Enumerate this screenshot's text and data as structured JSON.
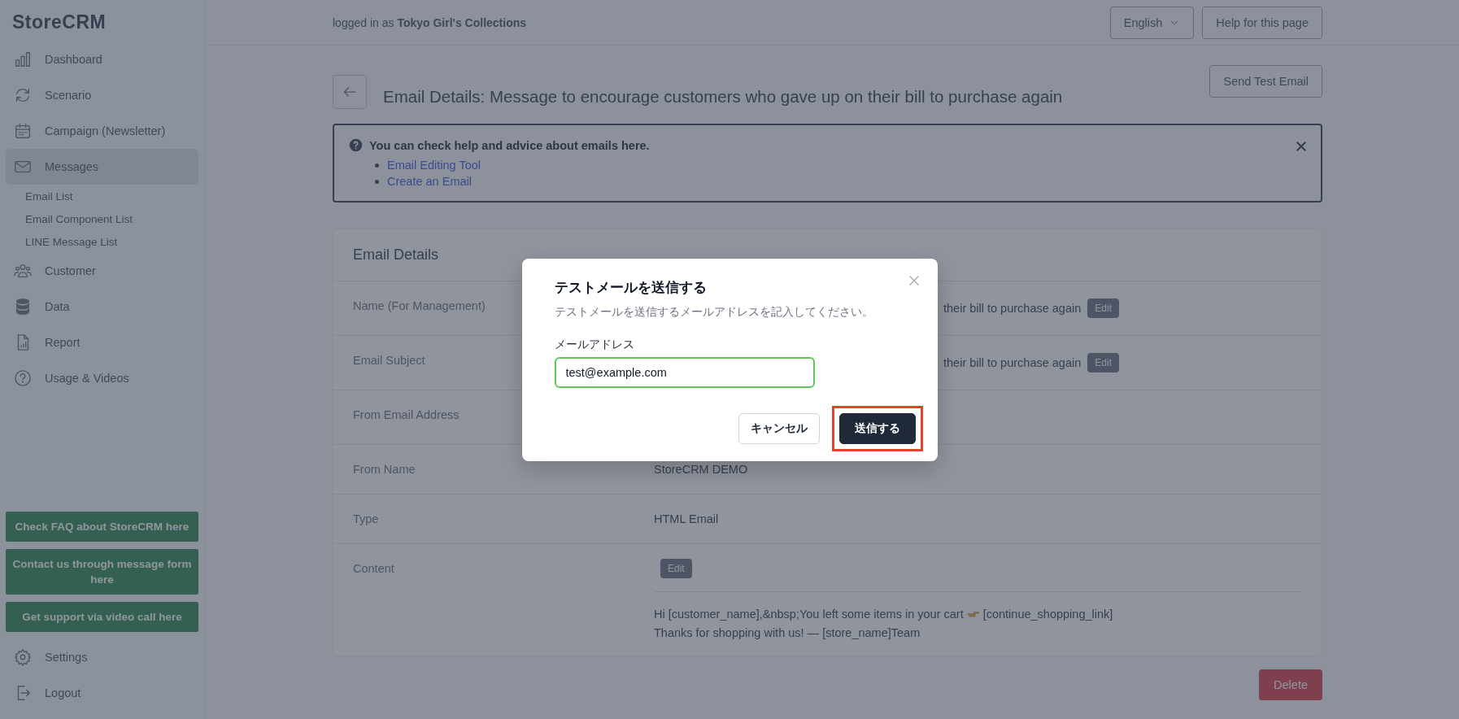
{
  "sidebar": {
    "logo": "StoreCRM",
    "items": [
      {
        "label": "Dashboard",
        "selected": false
      },
      {
        "label": "Scenario",
        "selected": false
      },
      {
        "label": "Campaign (Newsletter)",
        "selected": false
      },
      {
        "label": "Messages",
        "selected": true,
        "children": [
          {
            "label": "Email List"
          },
          {
            "label": "Email Component List"
          },
          {
            "label": "LINE Message List"
          }
        ]
      },
      {
        "label": "Customer",
        "selected": false
      },
      {
        "label": "Data",
        "selected": false
      },
      {
        "label": "Report",
        "selected": false
      },
      {
        "label": "Usage & Videos",
        "selected": false
      }
    ],
    "support_buttons": [
      "Check FAQ about StoreCRM here",
      "Contact us through message form here",
      "Get support via video call here"
    ],
    "bottom_items": [
      {
        "label": "Settings"
      },
      {
        "label": "Logout"
      }
    ]
  },
  "header": {
    "login_text": "logged in as **Tokyo Girl's Collections**",
    "language": "English",
    "help_button": "Help for this page"
  },
  "page": {
    "title": "Email Details: Message to encourage customers who gave up on their bill to purchase again",
    "send_test_button": "Send Test Email",
    "help_box": {
      "heading": "You can check help and advice about emails here.",
      "links": [
        "Email Editing Tool",
        "Create an Email"
      ]
    },
    "details": {
      "title": "Email Details",
      "rows": [
        {
          "kind": "covered",
          "label": "Name (For Management)",
          "value": "their bill to purchase again",
          "edit": "Edit"
        },
        {
          "kind": "covered",
          "label": "Email Subject",
          "value": "their bill to purchase again",
          "edit": "Edit"
        },
        {
          "kind": "covered",
          "label": "From Email Address"
        },
        {
          "kind": "text",
          "label": "From Name",
          "value": "StoreCRM DEMO"
        },
        {
          "kind": "text",
          "label": "Type",
          "value": "HTML Email"
        },
        {
          "kind": "content",
          "label": "Content",
          "edit": "Edit",
          "line_1_start": "Hi [customer_name],&nbsp;You left some items in your cart",
          "line_1_end": "[continue_shopping_link]",
          "line_2": "Thanks for shopping with us! — [store_name]Team"
        }
      ]
    },
    "delete_button": "Delete"
  },
  "modal": {
    "title": "テストメールを送信する",
    "description": "テストメールを送信するメールアドレスを記入してください。",
    "field_label": "メールアドレス",
    "field_value": "test@example.com",
    "field_focused": true,
    "buttons": [
      {
        "label": "キャンセル",
        "kind": "secondary",
        "highlighted": false
      },
      {
        "label": "送信する",
        "kind": "primary",
        "highlighted": true
      }
    ]
  }
}
